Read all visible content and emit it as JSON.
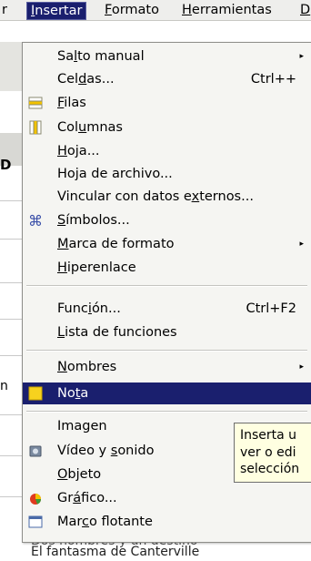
{
  "menubar": {
    "items": [
      {
        "label": "r",
        "mnemonic": ""
      },
      {
        "label": "Insertar",
        "mnemonic": "I"
      },
      {
        "label": "Formato",
        "mnemonic": "F"
      },
      {
        "label": "Herramientas",
        "mnemonic": "H"
      },
      {
        "label": "D",
        "mnemonic": "D"
      }
    ]
  },
  "background": {
    "column_letter": "D",
    "row_fragment": "n",
    "cell_text_1": "Dos nombres y un destino",
    "cell_text_2": "El fantasma de Canterville"
  },
  "menu": {
    "items": [
      {
        "pre": "Sa",
        "mn": "l",
        "post": "to manual",
        "shortcut": "",
        "submenu": true,
        "icon": ""
      },
      {
        "pre": "Cel",
        "mn": "d",
        "post": "as...",
        "shortcut": "Ctrl++",
        "submenu": false,
        "icon": ""
      },
      {
        "pre": "",
        "mn": "F",
        "post": "ilas",
        "shortcut": "",
        "submenu": false,
        "icon": "insert-rows-icon"
      },
      {
        "pre": "Col",
        "mn": "u",
        "post": "mnas",
        "shortcut": "",
        "submenu": false,
        "icon": "insert-columns-icon"
      },
      {
        "pre": "",
        "mn": "H",
        "post": "oja...",
        "shortcut": "",
        "submenu": false,
        "icon": ""
      },
      {
        "pre": "Hoja de archivo...",
        "mn": "",
        "post": "",
        "shortcut": "",
        "submenu": false,
        "icon": ""
      },
      {
        "pre": "Vincular con datos e",
        "mn": "x",
        "post": "ternos...",
        "shortcut": "",
        "submenu": false,
        "icon": ""
      },
      {
        "pre": "",
        "mn": "S",
        "post": "ímbolos...",
        "shortcut": "",
        "submenu": false,
        "icon": "special-character-icon"
      },
      {
        "pre": "",
        "mn": "M",
        "post": "arca de formato",
        "shortcut": "",
        "submenu": true,
        "icon": ""
      },
      {
        "pre": "",
        "mn": "H",
        "post": "iperenlace",
        "shortcut": "",
        "submenu": false,
        "icon": ""
      },
      {
        "pre": "Func",
        "mn": "i",
        "post": "ón...",
        "shortcut": "Ctrl+F2",
        "submenu": false,
        "icon": ""
      },
      {
        "pre": "",
        "mn": "L",
        "post": "ista de funciones",
        "shortcut": "",
        "submenu": false,
        "icon": ""
      },
      {
        "pre": "",
        "mn": "N",
        "post": "ombres",
        "shortcut": "",
        "submenu": true,
        "icon": ""
      },
      {
        "pre": "No",
        "mn": "t",
        "post": "a",
        "shortcut": "",
        "submenu": false,
        "icon": "note-icon",
        "highlighted": true
      },
      {
        "pre": "Imagen",
        "mn": "",
        "post": "",
        "shortcut": "",
        "submenu": false,
        "icon": ""
      },
      {
        "pre": "Vídeo y ",
        "mn": "s",
        "post": "onido",
        "shortcut": "",
        "submenu": false,
        "icon": "movie-sound-icon"
      },
      {
        "pre": "",
        "mn": "O",
        "post": "bjeto",
        "shortcut": "",
        "submenu": false,
        "icon": ""
      },
      {
        "pre": "Gr",
        "mn": "á",
        "post": "fico...",
        "shortcut": "",
        "submenu": false,
        "icon": "chart-icon"
      },
      {
        "pre": "Mar",
        "mn": "c",
        "post": "o flotante",
        "shortcut": "",
        "submenu": false,
        "icon": "floating-frame-icon"
      }
    ],
    "submenu_arrow": "▸"
  },
  "tooltip": {
    "lines": [
      "Inserta u",
      "ver o edi",
      "selección"
    ]
  },
  "colors": {
    "highlight": "#1a1f6e",
    "menu_bg": "#f5f5f2",
    "tooltip_bg": "#ffffe1"
  }
}
